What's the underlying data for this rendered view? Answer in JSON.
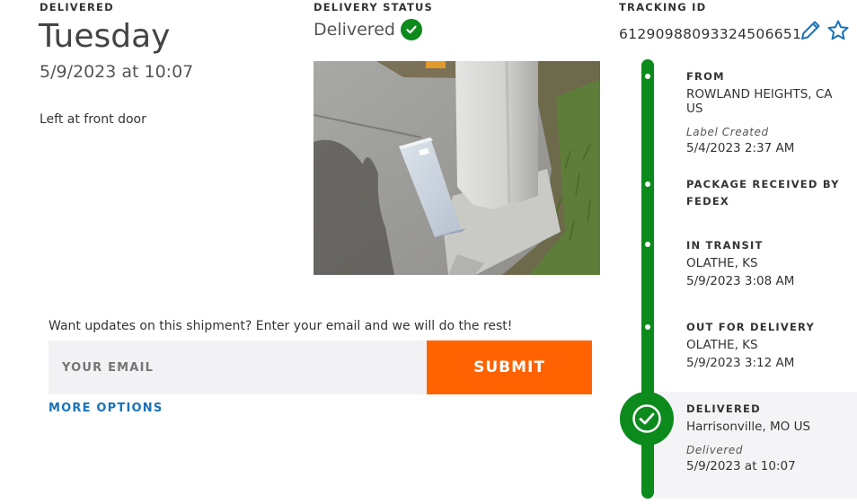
{
  "delivered": {
    "label": "DELIVERED",
    "day": "Tuesday",
    "datetime": "5/9/2023 at 10:07",
    "note": "Left at front door"
  },
  "status": {
    "label": "DELIVERY STATUS",
    "value": "Delivered"
  },
  "tracking": {
    "label": "TRACKING ID",
    "number": "612909880933245066​51"
  },
  "photo": {
    "alt": "Package left at front door"
  },
  "email": {
    "prompt": "Want updates on this shipment? Enter your email and we will do the rest!",
    "placeholder": "YOUR EMAIL",
    "submit": "SUBMIT",
    "more_options": "MORE OPTIONS"
  },
  "timeline": [
    {
      "title": "FROM",
      "location": "ROWLAND HEIGHTS, CA US",
      "note": "Label Created",
      "time": "5/4/2023 2:37 AM"
    },
    {
      "title": "PACKAGE RECEIVED BY FEDEX",
      "location": "",
      "note": "",
      "time": ""
    },
    {
      "title": "IN TRANSIT",
      "location": "OLATHE, KS",
      "note": "",
      "time": "5/9/2023 3:08 AM"
    },
    {
      "title": "OUT FOR DELIVERY",
      "location": "OLATHE, KS",
      "note": "",
      "time": "5/9/2023 3:12 AM"
    },
    {
      "title": "DELIVERED",
      "location": "Harrisonville, MO US",
      "note": "Delivered",
      "time": "5/9/2023 at 10:07"
    }
  ],
  "colors": {
    "accent_green": "#0d8a1c",
    "submit_orange": "#ff6200",
    "link_blue": "#1a73b8"
  },
  "icons": {
    "status": "check-circle-icon",
    "edit": "pencil-icon",
    "favorite": "star-icon",
    "delivered": "check-circle-icon"
  }
}
